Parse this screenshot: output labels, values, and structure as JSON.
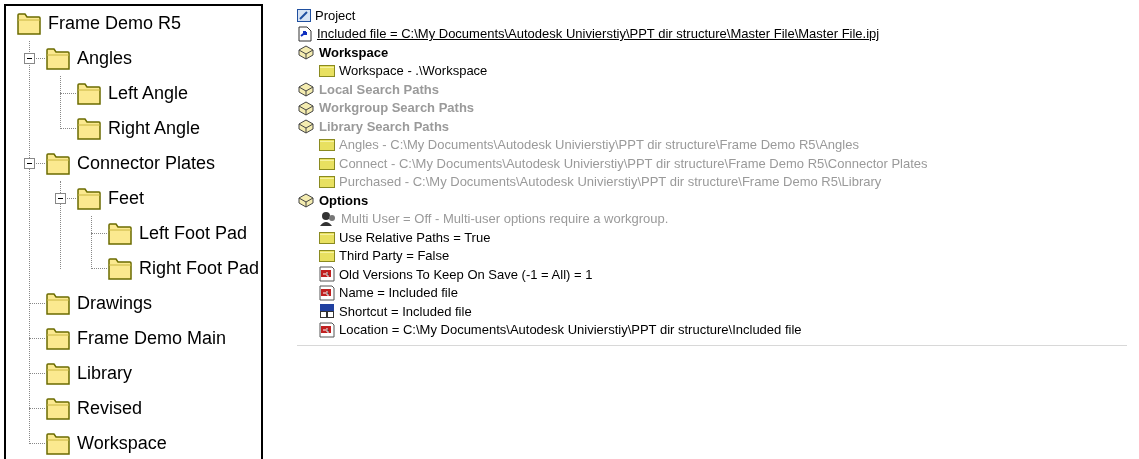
{
  "folder_tree": {
    "label": "Frame Demo R5",
    "children": [
      {
        "label": "Angles",
        "expanded": true,
        "children": [
          {
            "label": "Left Angle"
          },
          {
            "label": "Right Angle"
          }
        ]
      },
      {
        "label": "Connector Plates",
        "expanded": true,
        "children": [
          {
            "label": "Feet",
            "expanded": true,
            "children": [
              {
                "label": "Left Foot Pad"
              },
              {
                "label": "Right Foot Pad"
              }
            ]
          }
        ]
      },
      {
        "label": "Drawings"
      },
      {
        "label": "Frame Demo Main"
      },
      {
        "label": "Library"
      },
      {
        "label": "Revised"
      },
      {
        "label": "Workspace"
      }
    ]
  },
  "project": {
    "title": "Project",
    "items": [
      {
        "kind": "link",
        "label": "Included file = C:\\My Documents\\Autodesk Univierstiy\\PPT dir structure\\Master File\\Master File.ipj",
        "disabled": false
      },
      {
        "kind": "group",
        "label": "Workspace",
        "disabled": false,
        "children": [
          {
            "kind": "folder",
            "label": "Workspace - .\\Workspace",
            "disabled": false
          }
        ]
      },
      {
        "kind": "group",
        "label": "Local Search Paths",
        "disabled": true
      },
      {
        "kind": "group",
        "label": "Workgroup Search Paths",
        "disabled": true
      },
      {
        "kind": "group",
        "label": "Library Search Paths",
        "disabled": true,
        "children": [
          {
            "kind": "folder",
            "label": "Angles - C:\\My Documents\\Autodesk Univierstiy\\PPT dir structure\\Frame Demo R5\\Angles",
            "disabled": true
          },
          {
            "kind": "folder",
            "label": "Connect - C:\\My Documents\\Autodesk Univierstiy\\PPT dir structure\\Frame Demo R5\\Connector Plates",
            "disabled": true
          },
          {
            "kind": "folder",
            "label": "Purchased - C:\\My Documents\\Autodesk Univierstiy\\PPT dir structure\\Frame Demo R5\\Library",
            "disabled": true
          }
        ]
      },
      {
        "kind": "group",
        "label": "Options",
        "disabled": false,
        "children": [
          {
            "kind": "users",
            "label": "Multi User = Off - Multi-user options require a workgroup.",
            "disabled": true
          },
          {
            "kind": "folder",
            "label": "Use Relative Paths = True",
            "disabled": false
          },
          {
            "kind": "folder",
            "label": "Third Party = False",
            "disabled": false
          },
          {
            "kind": "text",
            "label": "Old Versions To Keep On Save (-1 = All) = 1",
            "disabled": false
          },
          {
            "kind": "text",
            "label": "Name = Included file",
            "disabled": false
          },
          {
            "kind": "shortcut",
            "label": "Shortcut = Included file",
            "disabled": false
          },
          {
            "kind": "text",
            "label": "Location = C:\\My Documents\\Autodesk Univierstiy\\PPT dir structure\\Included file",
            "disabled": false
          }
        ]
      }
    ]
  }
}
